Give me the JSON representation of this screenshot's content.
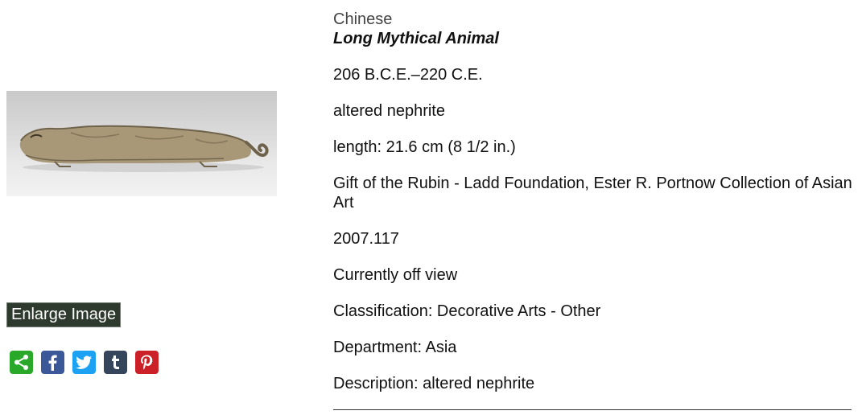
{
  "artwork": {
    "culture": "Chinese",
    "title": "Long Mythical Animal",
    "date": "206 B.C.E.–220 C.E.",
    "medium": "altered nephrite",
    "dimensions": "length: 21.6 cm (8 1/2 in.)",
    "credit_line": "Gift of the Rubin - Ladd Foundation, Ester R. Portnow Collection of Asian Art",
    "accession_number": "2007.117",
    "status": "Currently off view",
    "classification": "Classification: Decorative Arts - Other",
    "department": "Department: Asia",
    "description": "Description: altered nephrite"
  },
  "actions": {
    "enlarge_label": "Enlarge Image"
  },
  "share": [
    {
      "icon": "share-icon",
      "color": "#2aa82a"
    },
    {
      "icon": "facebook-icon",
      "color": "#3b5998"
    },
    {
      "icon": "twitter-icon",
      "color": "#1da1f2"
    },
    {
      "icon": "tumblr-icon",
      "color": "#35465c"
    },
    {
      "icon": "pinterest-icon",
      "color": "#cb2027"
    }
  ]
}
